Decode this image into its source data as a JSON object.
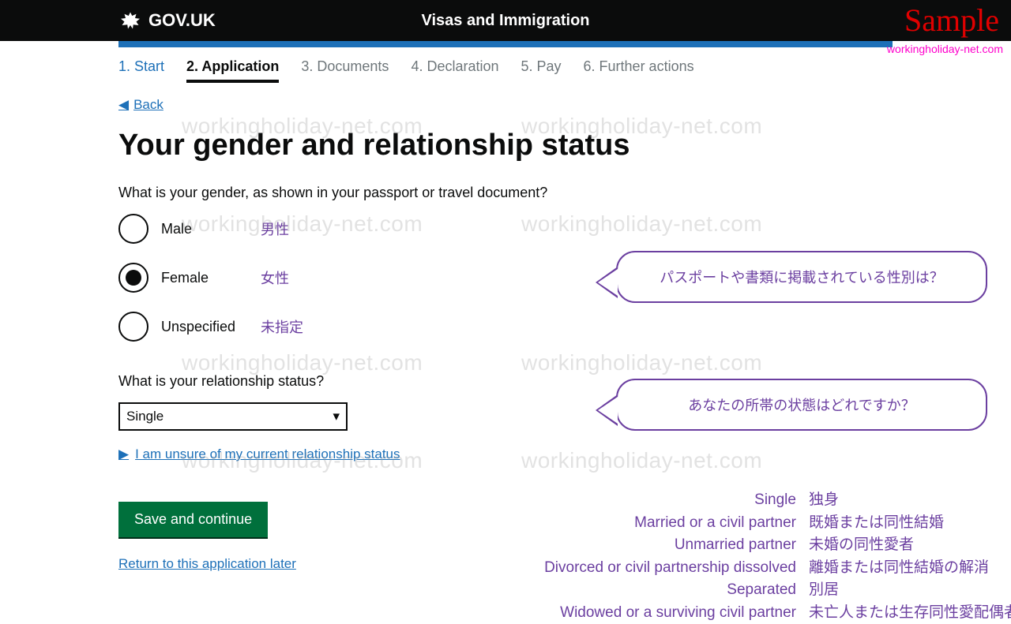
{
  "header": {
    "logo_text": "GOV.UK",
    "site_title": "Visas and Immigration"
  },
  "overlay": {
    "sample": "Sample",
    "domain": "workingholiday-net.com"
  },
  "progress": {
    "items": [
      {
        "label": "1. Start",
        "state": "done"
      },
      {
        "label": "2. Application",
        "state": "current"
      },
      {
        "label": "3. Documents",
        "state": "future"
      },
      {
        "label": "4. Declaration",
        "state": "future"
      },
      {
        "label": "5. Pay",
        "state": "future"
      },
      {
        "label": "6. Further actions",
        "state": "future"
      }
    ]
  },
  "back": "Back",
  "page_title": "Your gender and relationship status",
  "q_gender": "What is your gender, as shown in your passport or travel document?",
  "gender_options": [
    {
      "label": "Male",
      "jp": "男性",
      "selected": false
    },
    {
      "label": "Female",
      "jp": "女性",
      "selected": true
    },
    {
      "label": "Unspecified",
      "jp": "未指定",
      "selected": false
    }
  ],
  "q_relationship": "What is your relationship status?",
  "relationship_selected": "Single",
  "unsure_link": "I am unsure of my current relationship status",
  "save_button": "Save and continue",
  "return_link": "Return to this application later",
  "bubble_gender": "パスポートや書類に掲載されている性別は？",
  "bubble_relationship": "あなたの所帯の状態はどれですか？",
  "relationship_options": [
    {
      "en": "Single",
      "jp": "独身"
    },
    {
      "en": "Married or a civil partner",
      "jp": "既婚または同性結婚"
    },
    {
      "en": "Unmarried partner",
      "jp": "未婚の同性愛者"
    },
    {
      "en": "Divorced or civil partnership dissolved",
      "jp": "離婚または同性結婚の解消"
    },
    {
      "en": "Separated",
      "jp": "別居"
    },
    {
      "en": "Widowed or a surviving civil partner",
      "jp": "未亡人または生存同性愛配偶者"
    }
  ],
  "watermark_text": "workingholiday-net.com"
}
